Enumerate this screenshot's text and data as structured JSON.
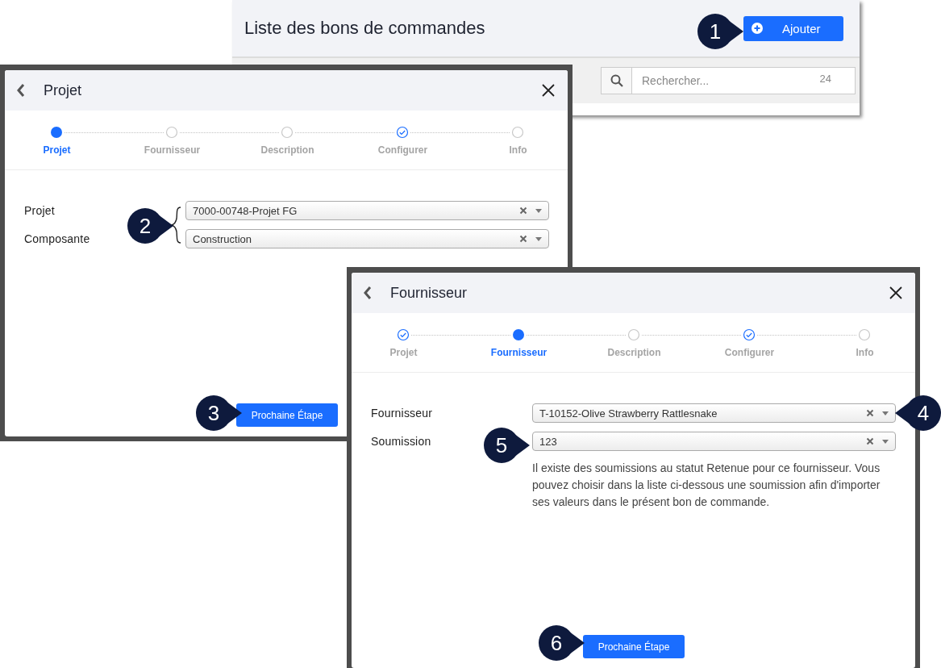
{
  "list_page": {
    "title": "Liste des bons de commandes",
    "add_button": "Ajouter",
    "search": {
      "placeholder": "Rechercher...",
      "count": "24"
    }
  },
  "dialogs": [
    {
      "title": "Projet",
      "steps": [
        {
          "label": "Projet",
          "selected": true,
          "done": false
        },
        {
          "label": "Fournisseur",
          "selected": false,
          "done": false
        },
        {
          "label": "Description",
          "selected": false,
          "done": false
        },
        {
          "label": "Configurer",
          "selected": false,
          "done": true
        },
        {
          "label": "Info",
          "selected": false,
          "done": false
        }
      ],
      "fields": [
        {
          "label": "Projet",
          "value": "7000-00748-Projet FG"
        },
        {
          "label": "Composante",
          "value": "Construction"
        }
      ],
      "next_button": "Prochaine Étape"
    },
    {
      "title": "Fournisseur",
      "steps": [
        {
          "label": "Projet",
          "selected": false,
          "done": true
        },
        {
          "label": "Fournisseur",
          "selected": true,
          "done": false
        },
        {
          "label": "Description",
          "selected": false,
          "done": false
        },
        {
          "label": "Configurer",
          "selected": false,
          "done": true
        },
        {
          "label": "Info",
          "selected": false,
          "done": false
        }
      ],
      "fields": [
        {
          "label": "Fournisseur",
          "value": "T-10152-Olive Strawberry Rattlesnake"
        },
        {
          "label": "Soumission",
          "value": "123"
        }
      ],
      "note": "Il existe des soumissions au statut Retenue pour ce fournisseur. Vous pouvez choisir dans la liste ci-dessous une soumission afin d'importer ses valeurs dans le présent bon de commande.",
      "next_button": "Prochaine Étape"
    }
  ],
  "callouts": [
    {
      "number": "1",
      "kind": "right"
    },
    {
      "number": "2",
      "kind": "right"
    },
    {
      "number": "3",
      "kind": "right"
    },
    {
      "number": "4",
      "kind": "left"
    },
    {
      "number": "5",
      "kind": "right"
    },
    {
      "number": "6",
      "kind": "right"
    }
  ]
}
